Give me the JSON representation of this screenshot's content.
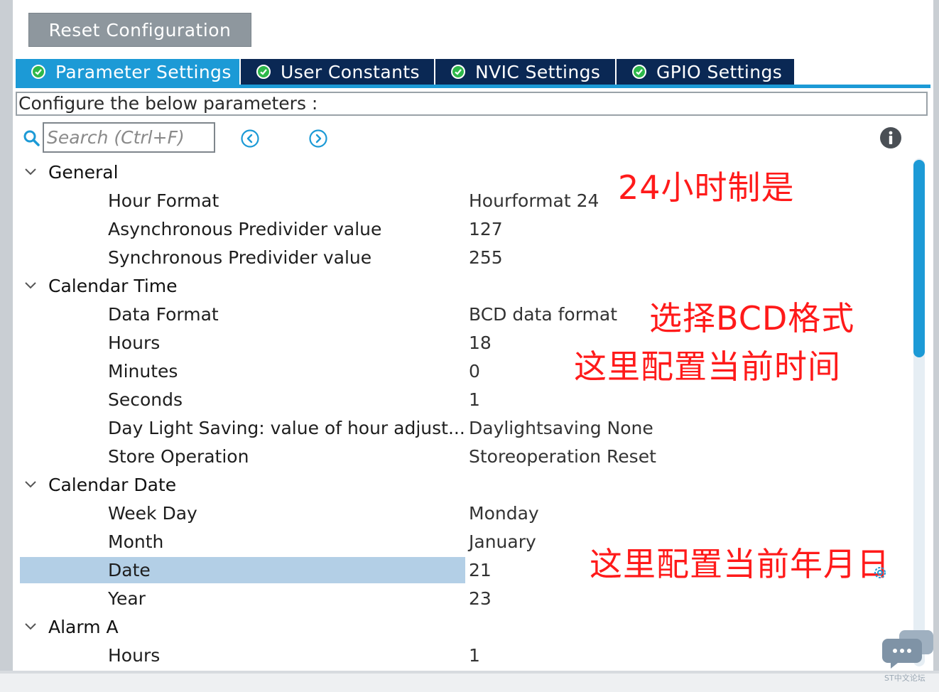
{
  "toolbar": {
    "reset_label": "Reset Configuration"
  },
  "tabs": [
    {
      "label": "Parameter Settings",
      "active": true
    },
    {
      "label": "User Constants",
      "active": false
    },
    {
      "label": "NVIC Settings",
      "active": false
    },
    {
      "label": "GPIO Settings",
      "active": false
    }
  ],
  "config_title": "Configure the below parameters :",
  "search": {
    "placeholder": "Search (Ctrl+F)"
  },
  "tree": {
    "general": {
      "label": "General",
      "params": [
        {
          "label": "Hour Format",
          "value": "Hourformat 24"
        },
        {
          "label": "Asynchronous Predivider value",
          "value": "127"
        },
        {
          "label": "Synchronous Predivider value",
          "value": "255"
        }
      ]
    },
    "calendar_time": {
      "label": "Calendar Time",
      "params": [
        {
          "label": "Data Format",
          "value": "BCD data format"
        },
        {
          "label": "Hours",
          "value": "18"
        },
        {
          "label": "Minutes",
          "value": "0"
        },
        {
          "label": "Seconds",
          "value": "1"
        },
        {
          "label": "Day Light Saving: value of hour adjust...",
          "value": "Daylightsaving None"
        },
        {
          "label": "Store Operation",
          "value": "Storeoperation Reset"
        }
      ]
    },
    "calendar_date": {
      "label": "Calendar Date",
      "params": [
        {
          "label": "Week Day",
          "value": "Monday"
        },
        {
          "label": "Month",
          "value": "January"
        },
        {
          "label": "Date",
          "value": "21",
          "selected": true
        },
        {
          "label": "Year",
          "value": "23"
        }
      ]
    },
    "alarm_a": {
      "label": "Alarm A",
      "params": [
        {
          "label": "Hours",
          "value": "1"
        }
      ]
    }
  },
  "annotations": {
    "hour_format": "24小时制是",
    "bcd": "选择BCD格式",
    "time": "这里配置当前时间",
    "date": "这里配置当前年月日"
  },
  "watermark": "ST中文论坛",
  "colors": {
    "tab_active": "#1c9ad6",
    "tab_inactive": "#0a2854",
    "check_green": "#2db84a",
    "selection": "#b3cfe6",
    "annotation_red": "#ff1a1a"
  }
}
